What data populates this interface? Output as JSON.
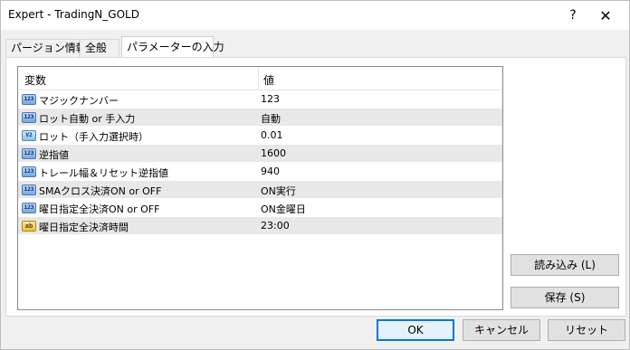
{
  "window": {
    "title": "Expert - TradingN_GOLD",
    "help_glyph": "?",
    "close_glyph": "✕"
  },
  "tabs": [
    {
      "label": "パージョン情報"
    },
    {
      "label": "全般"
    },
    {
      "label": "パラメーターの入力"
    }
  ],
  "table": {
    "headers": {
      "variable": "変数",
      "value": "値"
    },
    "rows": [
      {
        "icon": "int-icon",
        "icon_text": "123",
        "name": "マジックナンバー",
        "value": "123"
      },
      {
        "icon": "int-icon",
        "icon_text": "123",
        "name": "ロット自動 or 手入力",
        "value": "自動"
      },
      {
        "icon": "double-icon",
        "icon_text": "V2",
        "name": "ロット（手入力選択時）",
        "value": "0.01"
      },
      {
        "icon": "int-icon",
        "icon_text": "123",
        "name": "逆指値",
        "value": "1600"
      },
      {
        "icon": "int-icon",
        "icon_text": "123",
        "name": "トレール幅＆リセット逆指値",
        "value": "940"
      },
      {
        "icon": "int-icon",
        "icon_text": "123",
        "name": "SMAクロス決済ON or OFF",
        "value": "ON実行"
      },
      {
        "icon": "int-icon",
        "icon_text": "123",
        "name": "曜日指定全決済ON or OFF",
        "value": "ON金曜日"
      },
      {
        "icon": "string-icon",
        "icon_text": "ab",
        "name": "曜日指定全決済時間",
        "value": "23:00"
      }
    ]
  },
  "buttons": {
    "load": "読み込み (L)",
    "save": "保存 (S)",
    "ok": "OK",
    "cancel": "キャンセル",
    "reset": "リセット"
  }
}
